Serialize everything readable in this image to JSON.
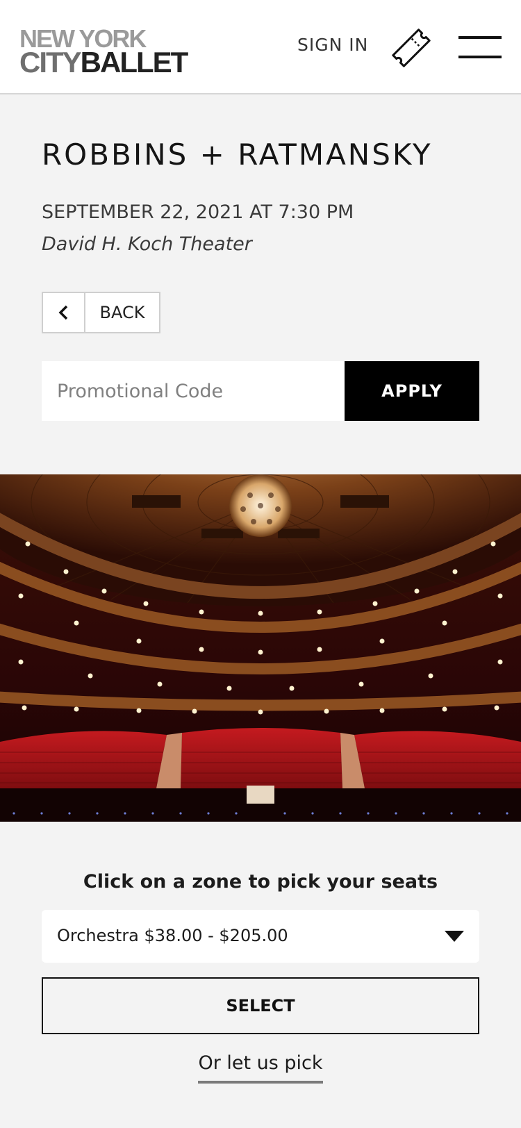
{
  "header": {
    "logo_line1": "NEW YORK",
    "logo_line2_a": "CITY",
    "logo_line2_b": "BALLET",
    "sign_in": "SIGN IN"
  },
  "event": {
    "title": "ROBBINS + RATMANSKY",
    "datetime": "SEPTEMBER 22, 2021 AT 7:30 PM",
    "venue": "David H. Koch Theater"
  },
  "back": {
    "label": "BACK"
  },
  "promo": {
    "placeholder": "Promotional Code",
    "value": "",
    "apply_label": "APPLY"
  },
  "seat_picker": {
    "heading": "Click on a zone to pick your seats",
    "zone_selected": "Orchestra $38.00 - $205.00",
    "select_label": "SELECT",
    "let_us_pick": "Or let us pick"
  },
  "colors": {
    "primary": "#000000",
    "background": "#f3f3f3",
    "seat_red": "#b3161b",
    "balcony_gold": "#8a4d1f"
  }
}
